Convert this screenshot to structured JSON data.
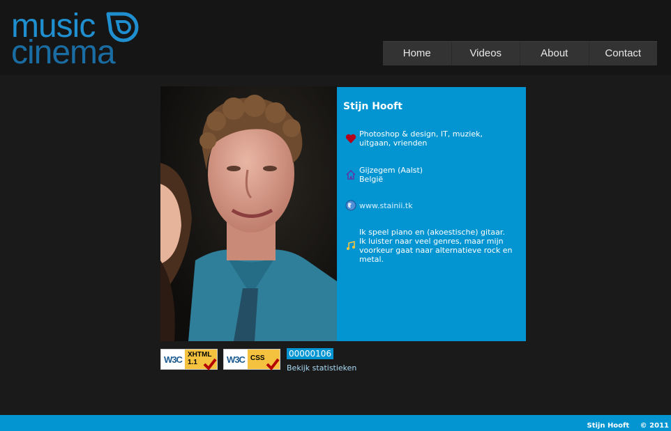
{
  "brand": {
    "line1": "music",
    "line2": "cinema"
  },
  "nav": {
    "items": [
      {
        "label": "Home"
      },
      {
        "label": "Videos"
      },
      {
        "label": "About"
      },
      {
        "label": "Contact"
      }
    ]
  },
  "profile": {
    "name": "Stijn Hooft",
    "interests": {
      "line1": "Photoshop & design, IT, muziek,",
      "line2": "uitgaan, vrienden",
      "icon": "heart-icon"
    },
    "location": {
      "line1": "Gijzegem (Aalst)",
      "line2": "België",
      "icon": "house-icon"
    },
    "website": {
      "label": "www.stainii.tk",
      "icon": "globe-icon"
    },
    "music": {
      "lines": [
        "Ik speel piano en (akoestische) gitaar.",
        "Ik luister naar veel genres, maar mijn",
        "voorkeur gaat naar alternatieve rock en",
        "metal."
      ],
      "icon": "music-note-icon"
    }
  },
  "badges": {
    "xhtml": {
      "logo": "W3C",
      "label1": "XHTML",
      "label2": "1.1"
    },
    "css": {
      "logo": "W3C",
      "label1": "CSS"
    }
  },
  "counter": {
    "value": "00000106",
    "stats_link": "Bekijk statistieken"
  },
  "footer": {
    "author": "Stijn Hooft",
    "copyright": "© 2011"
  },
  "colors": {
    "accent": "#0395d2",
    "background": "#1a1a1a",
    "nav": "#333333",
    "logo": "#1f8fcf"
  }
}
